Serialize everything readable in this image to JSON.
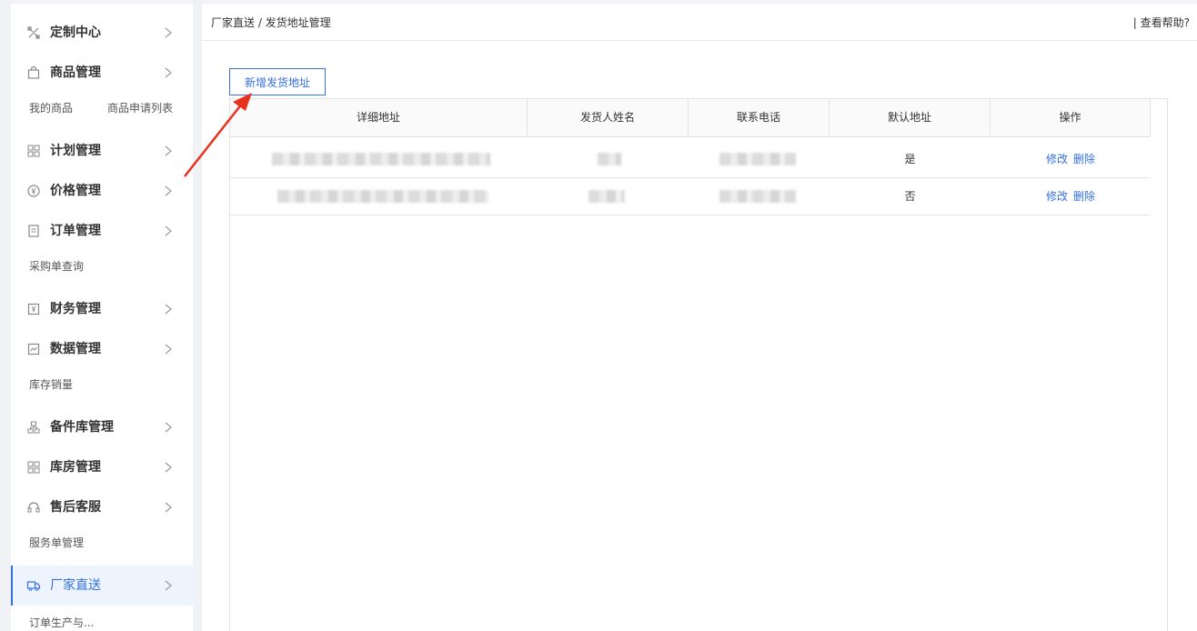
{
  "sidebar": {
    "menu": [
      {
        "label": "定制中心",
        "icon": "tools-icon"
      },
      {
        "label": "商品管理",
        "icon": "shopping-bag-icon"
      },
      {
        "label": "计划管理",
        "icon": "grid-icon"
      },
      {
        "label": "价格管理",
        "icon": "price-icon"
      },
      {
        "label": "订单管理",
        "icon": "order-icon"
      },
      {
        "label": "财务管理",
        "icon": "finance-icon"
      },
      {
        "label": "数据管理",
        "icon": "chart-icon"
      },
      {
        "label": "备件库管理",
        "icon": "parts-icon"
      },
      {
        "label": "库房管理",
        "icon": "warehouse-icon"
      },
      {
        "label": "售后客服",
        "icon": "headset-icon"
      },
      {
        "label": "厂家直送",
        "icon": "truck-icon"
      }
    ],
    "sub": {
      "goods_mine": "我的商品",
      "goods_apply": "商品申请列表",
      "purchase_query": "采购单查询",
      "stock_sales": "库存销量",
      "service_orders": "服务单管理",
      "order_production": "订单生产与..."
    }
  },
  "header": {
    "breadcrumb": "厂家直送 / 发货地址管理",
    "help": "| 查看帮助?"
  },
  "toolbar": {
    "add_label": "新增发货地址"
  },
  "table": {
    "columns": [
      "详细地址",
      "发货人姓名",
      "联系电话",
      "默认地址",
      "操作"
    ],
    "rows": [
      {
        "default": "是",
        "edit": "修改",
        "delete": "删除"
      },
      {
        "default": "否",
        "edit": "修改",
        "delete": "删除"
      }
    ]
  },
  "colors": {
    "accent": "#3370e0",
    "annotation_arrow": "#e8321e"
  }
}
